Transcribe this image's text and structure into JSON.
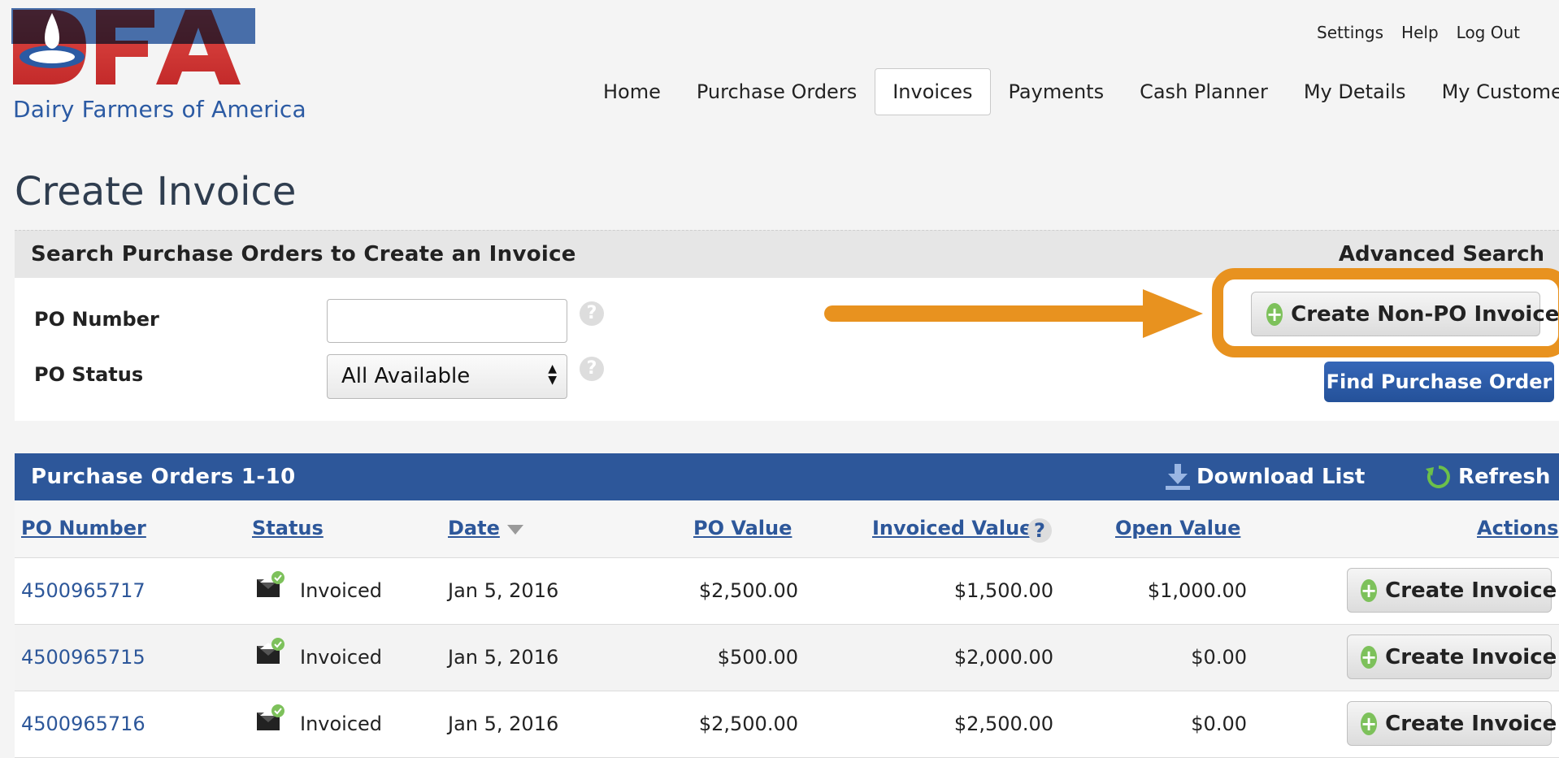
{
  "logo": {
    "letters": "DFA",
    "tagline": "Dairy Farmers of America"
  },
  "utility_nav": [
    "Settings",
    "Help",
    "Log Out"
  ],
  "main_nav": [
    {
      "label": "Home",
      "active": false
    },
    {
      "label": "Purchase Orders",
      "active": false
    },
    {
      "label": "Invoices",
      "active": true
    },
    {
      "label": "Payments",
      "active": false
    },
    {
      "label": "Cash Planner",
      "active": false
    },
    {
      "label": "My Details",
      "active": false
    },
    {
      "label": "My Customer",
      "active": false
    }
  ],
  "page_title": "Create Invoice",
  "search": {
    "heading": "Search Purchase Orders to Create an Invoice",
    "advanced_link": "Advanced Search",
    "po_number_label": "PO Number",
    "po_number_value": "",
    "po_status_label": "PO Status",
    "po_status_value": "All Available",
    "help_glyph": "?",
    "create_non_po_label": "Create Non-PO Invoice",
    "find_label": "Find Purchase Order"
  },
  "results": {
    "heading": "Purchase Orders 1-10",
    "download_label": "Download List",
    "refresh_label": "Refresh",
    "columns": {
      "po_number": "PO Number",
      "status": "Status",
      "date": "Date",
      "po_value": "PO Value",
      "invoiced_value": "Invoiced Value",
      "open_value": "Open Value",
      "actions": "Actions"
    },
    "rows": [
      {
        "po_number": "4500965717",
        "status": "Invoiced",
        "date": "Jan 5, 2016",
        "po_value": "$2,500.00",
        "invoiced_value": "$1,500.00",
        "open_value": "$1,000.00",
        "action": "Create Invoice"
      },
      {
        "po_number": "4500965715",
        "status": "Invoiced",
        "date": "Jan 5, 2016",
        "po_value": "$500.00",
        "invoiced_value": "$2,000.00",
        "open_value": "$0.00",
        "action": "Create Invoice"
      },
      {
        "po_number": "4500965716",
        "status": "Invoiced",
        "date": "Jan 5, 2016",
        "po_value": "$2,500.00",
        "invoiced_value": "$2,500.00",
        "open_value": "$0.00",
        "action": "Create Invoice"
      }
    ]
  },
  "colors": {
    "brand_blue": "#2d579a",
    "brand_red": "#d1302f",
    "highlight_orange": "#e8921f",
    "add_green": "#7dc15b"
  },
  "icons": [
    "droplet-icon",
    "help-icon",
    "select-arrows-icon",
    "plus-circle-icon",
    "arrow-right-icon",
    "download-icon",
    "refresh-icon",
    "sort-desc-icon",
    "invoiced-envelope-icon"
  ]
}
